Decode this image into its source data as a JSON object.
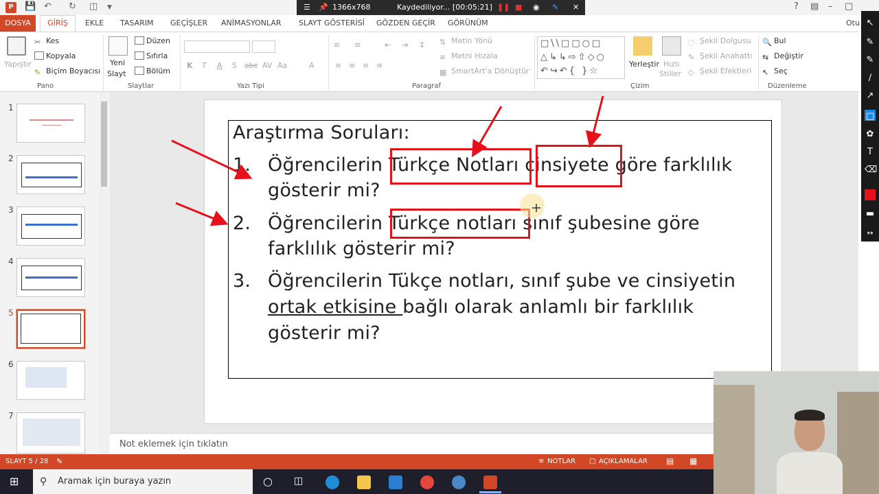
{
  "title_bar": {
    "recording_resolution": "1366x768",
    "recording_status": "Kaydediliyor... [00:05:21]",
    "account": "Otu"
  },
  "tabs": [
    "DOSYA",
    "GİRİŞ",
    "EKLE",
    "TASARIM",
    "GEÇİŞLER",
    "ANİMASYONLAR",
    "SLAYT GÖSTERİSİ",
    "GÖZDEN GEÇİR",
    "GÖRÜNÜM"
  ],
  "ribbon": {
    "pano": {
      "label": "Pano",
      "paste": "Yapıştır",
      "cut": "Kes",
      "copy": "Kopyala",
      "format_painter": "Biçim Boyacısı"
    },
    "slaytlar": {
      "label": "Slaytlar",
      "new_slide_1": "Yeni",
      "new_slide_2": "Slayt",
      "layout": "Düzen",
      "reset": "Sıfırla",
      "section": "Bölüm"
    },
    "yazi_tipi": {
      "label": "Yazı Tipi"
    },
    "paragraf": {
      "label": "Paragraf",
      "text_direction": "Metin Yönü",
      "align_text": "Metni Hizala",
      "smartart": "SmartArt'a Dönüştür"
    },
    "cizim": {
      "label": "Çizim",
      "arrange": "Yerleştir",
      "quick_styles_1": "Hızlı",
      "quick_styles_2": "Stiller",
      "shape_fill": "Şekil Dolgusu",
      "shape_outline": "Şekil Anahattı",
      "shape_effects": "Şekil Efektleri"
    },
    "duzenleme": {
      "label": "Düzenleme",
      "find": "Bul",
      "replace": "Değiştir",
      "select": "Seç"
    }
  },
  "thumbnails": [
    "1",
    "2",
    "3",
    "4",
    "5",
    "6",
    "7"
  ],
  "slide": {
    "heading": "Araştırma Soruları:",
    "items": [
      {
        "num": "1.",
        "line1_a": "Öğrencilerin ",
        "line1_b": "Türkçe Notları",
        "line1_c": " ",
        "line1_d": "cinsiyete",
        "line1_e": " göre farklılık",
        "line2": "gösterir mi?"
      },
      {
        "num": "2.",
        "line1_a": "Öğrencilerin ",
        "line1_b": "Türkçe notları",
        "line1_c": " sınıf şubesine göre",
        "line2": "farklılık gösterir mi?"
      },
      {
        "num": "3.",
        "line1": "Öğrencilerin Tükçe notları, sınıf şube ve cinsiyetin",
        "line2_a": "ortak etkisine ",
        "line2_b": "bağlı olarak anlamlı bir farklılık",
        "line3": "gösterir mi?"
      }
    ]
  },
  "notes_placeholder": "Not eklemek için tıklatın",
  "status": {
    "slide": "SLAYT 5 / 28",
    "notes": "NOTLAR",
    "comments": "AÇIKLAMALAR"
  },
  "taskbar": {
    "search": "Aramak için buraya yazın"
  },
  "colors": {
    "accent": "#d24726",
    "annotation": "#e8101a"
  }
}
